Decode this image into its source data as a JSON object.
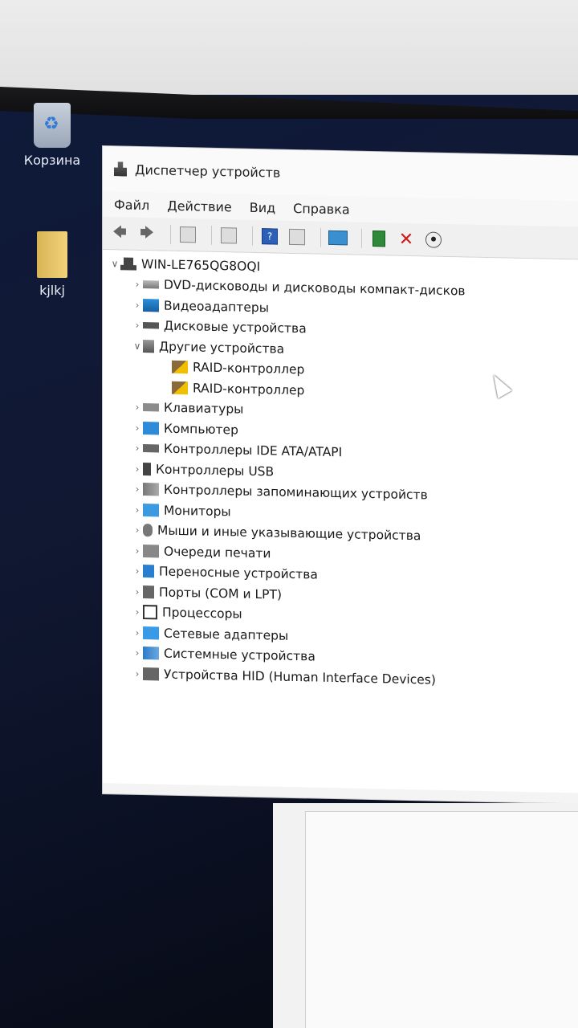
{
  "desktop": {
    "icons": [
      {
        "label": "Корзина",
        "icon": "recycle-bin-icon"
      },
      {
        "label": "kjlkj",
        "icon": "folder-icon"
      }
    ]
  },
  "window": {
    "title": "Диспетчер устройств",
    "menu": [
      "Файл",
      "Действие",
      "Вид",
      "Справка"
    ],
    "toolbar": [
      "back-arrow-icon",
      "forward-arrow-icon",
      "properties-icon",
      "update-icon",
      "help-icon",
      "view-icon",
      "monitor-icon",
      "driver-icon",
      "remove-icon",
      "download-icon"
    ],
    "tree": {
      "root": "WIN-LE765QG8OQI",
      "categories": [
        {
          "label": "DVD-дисководы и дисководы компакт-дисков",
          "icon": "dvd"
        },
        {
          "label": "Видеоадаптеры",
          "icon": "video"
        },
        {
          "label": "Дисковые устройства",
          "icon": "disk"
        },
        {
          "label": "Другие устройства",
          "icon": "other",
          "expanded": true,
          "children": [
            "RAID-контроллер",
            "RAID-контроллер"
          ]
        },
        {
          "label": "Клавиатуры",
          "icon": "keyboard"
        },
        {
          "label": "Компьютер",
          "icon": "pc"
        },
        {
          "label": "Контроллеры IDE ATA/ATAPI",
          "icon": "ide"
        },
        {
          "label": "Контроллеры USB",
          "icon": "usb"
        },
        {
          "label": "Контроллеры запоминающих устройств",
          "icon": "storage"
        },
        {
          "label": "Мониторы",
          "icon": "monitor"
        },
        {
          "label": "Мыши и иные указывающие устройства",
          "icon": "mouse"
        },
        {
          "label": "Очереди печати",
          "icon": "printer"
        },
        {
          "label": "Переносные устройства",
          "icon": "portable"
        },
        {
          "label": "Порты (COM и LPT)",
          "icon": "ports"
        },
        {
          "label": "Процессоры",
          "icon": "cpu"
        },
        {
          "label": "Сетевые адаптеры",
          "icon": "net"
        },
        {
          "label": "Системные устройства",
          "icon": "sys"
        },
        {
          "label": "Устройства HID (Human Interface Devices)",
          "icon": "hid"
        }
      ]
    }
  }
}
